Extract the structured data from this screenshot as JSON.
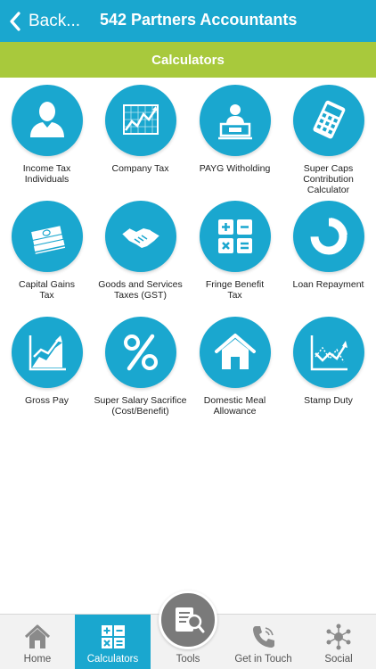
{
  "header": {
    "back_label": "Back...",
    "title": "542 Partners Accountants"
  },
  "section": {
    "title": "Calculators"
  },
  "tiles": [
    {
      "label": "Income Tax\nIndividuals",
      "icon": "person-icon"
    },
    {
      "label": "Company Tax",
      "icon": "chart-board-icon"
    },
    {
      "label": "PAYG Witholding",
      "icon": "worker-desk-icon"
    },
    {
      "label": "Super Caps\nContribution Calculator",
      "icon": "calculator-icon"
    },
    {
      "label": "Capital Gains\nTax",
      "icon": "money-stack-icon"
    },
    {
      "label": "Goods and Services\nTaxes (GST)",
      "icon": "handshake-icon"
    },
    {
      "label": "Fringe Benefit\nTax",
      "icon": "math-operators-icon"
    },
    {
      "label": "Loan Repayment",
      "icon": "donut-chart-icon"
    },
    {
      "label": "Gross Pay",
      "icon": "growth-chart-icon"
    },
    {
      "label": "Super Salary Sacrifice\n(Cost/Benefit)",
      "icon": "percent-icon"
    },
    {
      "label": "Domestic Meal\nAllowance",
      "icon": "house-icon"
    },
    {
      "label": "Stamp Duty",
      "icon": "line-graph-icon"
    }
  ],
  "tabbar": {
    "tabs": [
      {
        "label": "Home",
        "icon": "home-icon"
      },
      {
        "label": "Calculators",
        "icon": "calculator-tab-icon"
      },
      {
        "label": "Tools",
        "icon": "document-search-icon"
      },
      {
        "label": "Get in Touch",
        "icon": "phone-icon"
      },
      {
        "label": "Social",
        "icon": "network-icon"
      }
    ],
    "active": "Calculators"
  },
  "colors": {
    "primary": "#1aa7cf",
    "accent": "#a8c93c",
    "tab_bg": "#f2f2f2"
  }
}
